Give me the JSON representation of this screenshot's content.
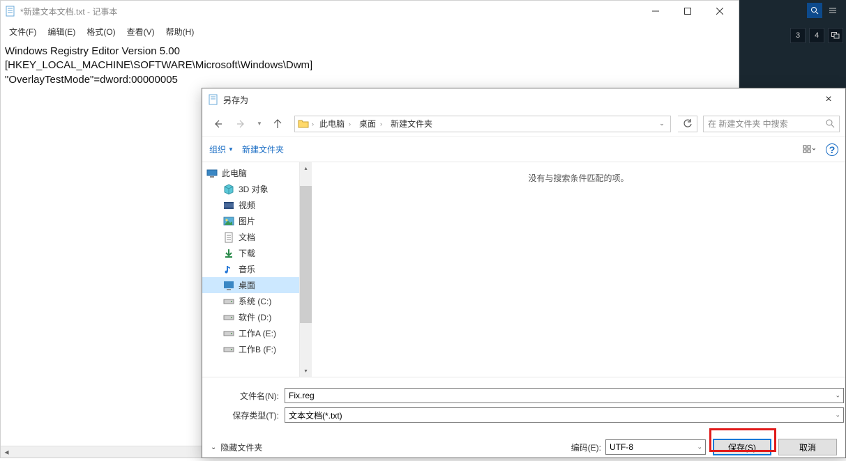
{
  "notepad": {
    "title": "*新建文本文档.txt - 记事本",
    "menu": [
      "文件(F)",
      "编辑(E)",
      "格式(O)",
      "查看(V)",
      "帮助(H)"
    ],
    "content": "Windows Registry Editor Version 5.00\n[HKEY_LOCAL_MACHINE\\SOFTWARE\\Microsoft\\Windows\\Dwm]\n\"OverlayTestMode\"=dword:00000005"
  },
  "darkpanel": {
    "tiles": [
      "3",
      "4"
    ]
  },
  "saveas": {
    "title": "另存为",
    "breadcrumbs": [
      "此电脑",
      "桌面",
      "新建文件夹"
    ],
    "search_placeholder": "在 新建文件夹 中搜索",
    "toolbar": {
      "organize": "组织",
      "newfolder": "新建文件夹"
    },
    "tree": {
      "root": "此电脑",
      "items": [
        {
          "label": "3D 对象",
          "icon": "cube"
        },
        {
          "label": "视频",
          "icon": "video"
        },
        {
          "label": "图片",
          "icon": "image"
        },
        {
          "label": "文档",
          "icon": "doc"
        },
        {
          "label": "下载",
          "icon": "download"
        },
        {
          "label": "音乐",
          "icon": "music"
        },
        {
          "label": "桌面",
          "icon": "desktop",
          "selected": true
        },
        {
          "label": "系统 (C:)",
          "icon": "drive"
        },
        {
          "label": "软件 (D:)",
          "icon": "drive"
        },
        {
          "label": "工作A (E:)",
          "icon": "drive"
        },
        {
          "label": "工作B (F:)",
          "icon": "drive"
        }
      ]
    },
    "empty_msg": "没有与搜索条件匹配的项。",
    "filename_label": "文件名(N):",
    "filename_value": "Fix.reg",
    "filetype_label": "保存类型(T):",
    "filetype_value": "文本文档(*.txt)",
    "hide_folders": "隐藏文件夹",
    "encoding_label": "编码(E):",
    "encoding_value": "UTF-8",
    "save_btn": "保存(S)",
    "cancel_btn": "取消"
  }
}
